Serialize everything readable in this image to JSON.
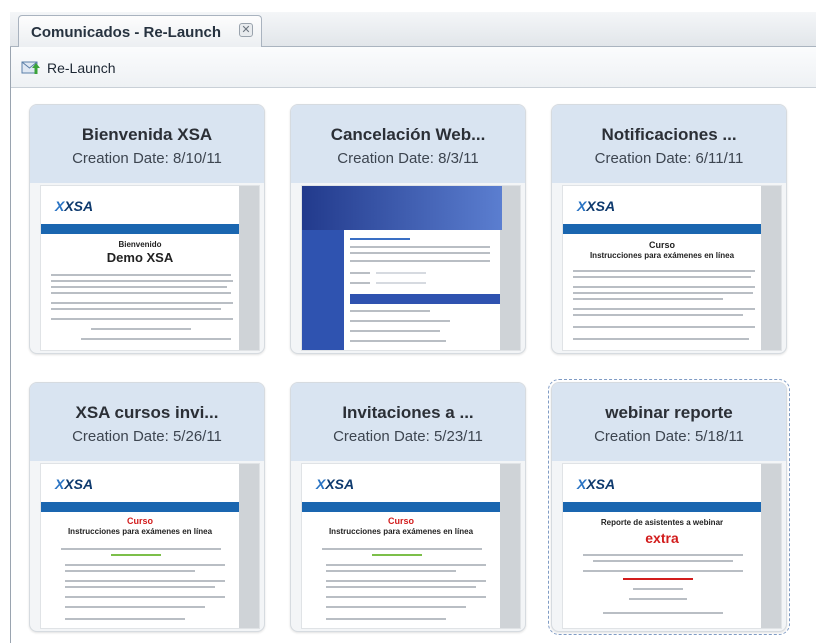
{
  "tab": {
    "title": "Comunicados - Re-Launch",
    "close_glyph": "✕"
  },
  "toolbar": {
    "relaunch_label": "Re-Launch",
    "relaunch_icon": "mail-send-icon"
  },
  "cards": [
    {
      "title": "Bienvenida XSA",
      "date": "Creation Date: 8/10/11",
      "thumb": {
        "logo": "XSA",
        "heading1": "Bienvenido",
        "heading2": "Demo XSA"
      }
    },
    {
      "title": "Cancelación Web...",
      "date": "Creation Date: 8/3/11",
      "thumb": {}
    },
    {
      "title": "Notificaciones ...",
      "date": "Creation Date: 6/11/11",
      "thumb": {
        "logo": "XSA",
        "heading1": "Curso",
        "heading2": "Instrucciones para exámenes en línea"
      }
    },
    {
      "title": "XSA cursos invi...",
      "date": "Creation Date: 5/26/11",
      "thumb": {
        "logo": "XSA",
        "heading1": "Curso",
        "heading2": "Instrucciones para exámenes en línea"
      }
    },
    {
      "title": "Invitaciones a ...",
      "date": "Creation Date: 5/23/11",
      "thumb": {
        "logo": "XSA",
        "heading1": "Curso",
        "heading2": "Instrucciones para exámenes en línea"
      }
    },
    {
      "title": "webinar reporte",
      "date": "Creation Date: 5/18/11",
      "thumb": {
        "logo": "XSA",
        "heading1": "Reporte de asistentes a webinar",
        "heading2": "extra"
      }
    }
  ],
  "colors": {
    "card_header": "#d9e4f1",
    "accent_blue": "#1a66b0",
    "red": "#d21c1c"
  }
}
